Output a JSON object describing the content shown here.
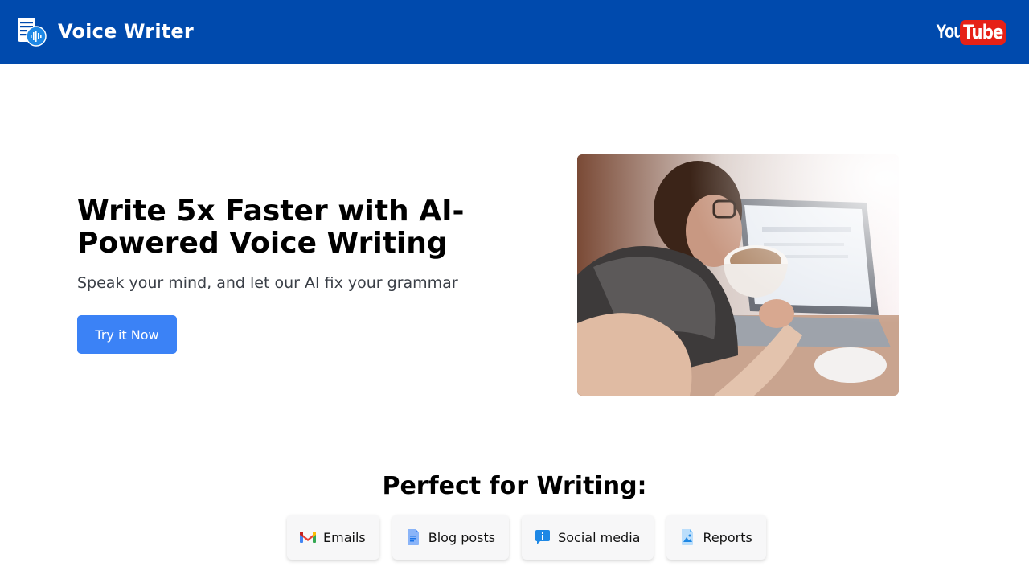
{
  "header": {
    "app_name": "Voice Writer",
    "youtube_you": "You",
    "youtube_tube": "Tube",
    "brand_color": "#004aad",
    "youtube_red": "#e62117"
  },
  "hero": {
    "title": "Write 5x Faster with AI-Powered Voice Writing",
    "subtitle": "Speak your mind, and let our AI fix your grammar",
    "cta_label": "Try it Now",
    "cta_color": "#3b82f6",
    "image": "woman-drinking-coffee-at-laptop"
  },
  "uses": {
    "title": "Perfect for Writing:",
    "items": [
      {
        "label": "Emails",
        "icon": "gmail-icon"
      },
      {
        "label": "Blog posts",
        "icon": "document-icon"
      },
      {
        "label": "Social media",
        "icon": "chat-icon"
      },
      {
        "label": "Reports",
        "icon": "image-icon"
      }
    ]
  }
}
